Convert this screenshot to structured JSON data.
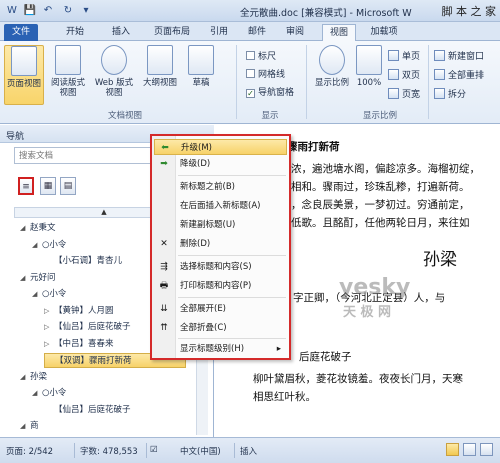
{
  "title_bar": {
    "doc_title": "全元散曲.doc [兼容模式] - Microsoft W",
    "site_mark": "脚 本 之 家",
    "quick_access": [
      "W",
      "💾",
      "↶",
      "↻",
      "▾"
    ]
  },
  "tabs": [
    "文件",
    "开始",
    "插入",
    "页面布局",
    "引用",
    "邮件",
    "审阅",
    "视图",
    "加载项"
  ],
  "ribbon": {
    "views": [
      "页面视图",
      "阅读版式视图",
      "Web 版式视图",
      "大纲视图",
      "草稿"
    ],
    "views_group": "文档视图",
    "show_checks": [
      {
        "label": "标尺",
        "checked": false
      },
      {
        "label": "网格线",
        "checked": false
      },
      {
        "label": "导航窗格",
        "checked": true
      }
    ],
    "show_group": "显示",
    "zoom_big": [
      "显示比例",
      "100%"
    ],
    "zoom_small": [
      "单页",
      "双页",
      "页宽"
    ],
    "zoom_group": "显示比例",
    "window_btns": [
      "新建窗口",
      "全部重排",
      "拆分"
    ]
  },
  "nav": {
    "title": "导航",
    "search_placeholder": "搜索文档",
    "tab_icons": [
      "≡",
      "▦",
      "▤"
    ],
    "tree": [
      {
        "label": "赵秉文",
        "level": 0,
        "twisty": "◢"
      },
      {
        "label": "○小令",
        "level": 1,
        "twisty": "◢"
      },
      {
        "label": "【小石调】青杏儿",
        "level": 2,
        "twisty": ""
      },
      {
        "label": "元好问",
        "level": 0,
        "twisty": "◢"
      },
      {
        "label": "○小令",
        "level": 1,
        "twisty": "◢"
      },
      {
        "label": "【黄钟】人月圆",
        "level": 2,
        "twisty": "▷"
      },
      {
        "label": "【仙吕】后庭花破子",
        "level": 2,
        "twisty": "▷"
      },
      {
        "label": "【中吕】喜春来",
        "level": 2,
        "twisty": "▷"
      },
      {
        "label": "【双调】骤雨打新荷",
        "level": 2,
        "twisty": "",
        "selected": true
      },
      {
        "label": "孙梁",
        "level": 0,
        "twisty": "◢"
      },
      {
        "label": "○小令",
        "level": 1,
        "twisty": "◢"
      },
      {
        "label": "【仙吕】后庭花破子",
        "level": 2,
        "twisty": ""
      },
      {
        "label": "商",
        "level": 0,
        "twisty": "◢"
      }
    ]
  },
  "context_menu": {
    "items": [
      {
        "icon": "⬅",
        "label": "升级(M)",
        "selected": true
      },
      {
        "icon": "➡",
        "label": "降级(D)"
      },
      {
        "icon": "",
        "label": "新标题之前(B)"
      },
      {
        "icon": "",
        "label": "在后面插入新标题(A)"
      },
      {
        "icon": "",
        "label": "新建副标题(U)"
      },
      {
        "icon": "✕",
        "label": "删除(D)"
      },
      {
        "icon": "⇶",
        "label": "选择标题和内容(S)"
      },
      {
        "icon": "🖶",
        "label": "打印标题和内容(P)"
      },
      {
        "icon": "⇊",
        "label": "全部展开(E)"
      },
      {
        "icon": "⇈",
        "label": "全部折叠(C)"
      },
      {
        "icon": "",
        "label": "显示标题级别(H)",
        "arrow": "▸"
      }
    ]
  },
  "document": {
    "line_heading": "骤雨打新荷",
    "lines": [
      "浓，遍池塘水阁，偏趁凉多。海榴初绽，",
      "相和。骤雨过，珍珠乱糁，打遍新荷。",
      "，念良辰美景，一梦初过。穷通前定，",
      "低歌。且酩酊，任他两轮日月，来往如"
    ],
    "title": "孙梁",
    "bio": "字正卿，（今河北正定县）人，与",
    "subheading": "后庭花破子",
    "para": [
      "柳叶黛眉秋，菱花妆镜羞。夜夜长门月，天寒",
      "相思红叶秋。"
    ],
    "watermark1": "yesky",
    "watermark2": "天 极 网"
  },
  "status": {
    "page": "页面: 2/542",
    "words": "字数: 478,553",
    "lang": "中文(中国)",
    "mode": "插入"
  }
}
